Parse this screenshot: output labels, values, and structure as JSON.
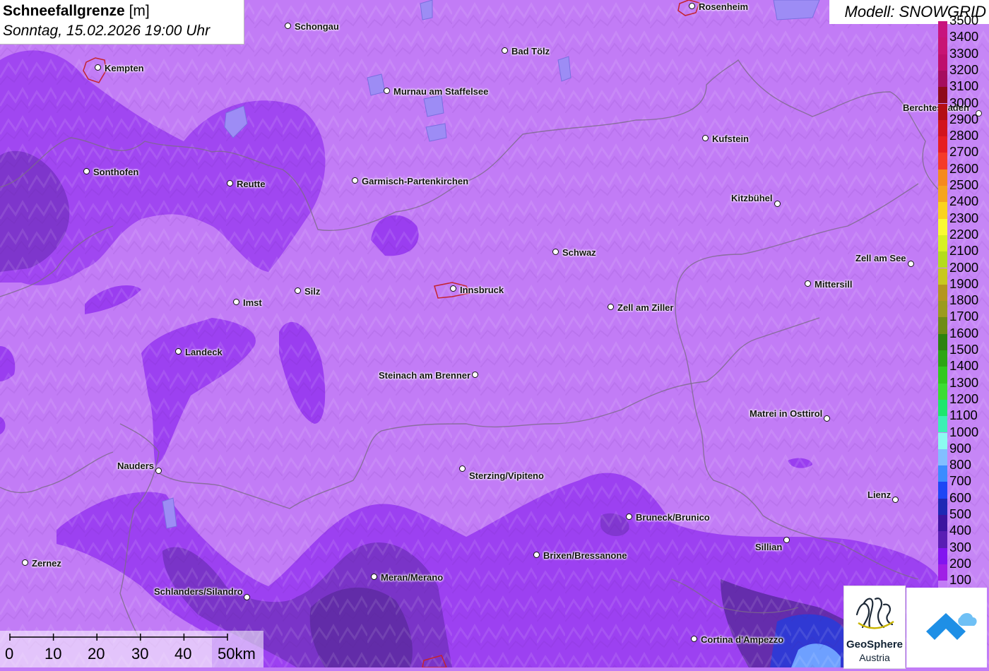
{
  "title": {
    "bold": "Schneefallgrenze",
    "unit": " [m]",
    "subtitle": "Sonntag, 15.02.2026 19:00 Uhr"
  },
  "model_label": "Modell: SNOWGRID",
  "legend": {
    "labels": [
      "3500",
      "3400",
      "3300",
      "3200",
      "3100",
      "3000",
      "2900",
      "2800",
      "2700",
      "2600",
      "2500",
      "2400",
      "2300",
      "2200",
      "2100",
      "2000",
      "1900",
      "1800",
      "1700",
      "1600",
      "1500",
      "1400",
      "1300",
      "1200",
      "1100",
      "1000",
      "900",
      "800",
      "700",
      "600",
      "500",
      "400",
      "300",
      "200",
      "100"
    ],
    "colors": [
      "#c8147e",
      "#c81474",
      "#be0f6c",
      "#a60d5f",
      "#8f0a1a",
      "#b40f14",
      "#d2141e",
      "#e61e23",
      "#f53a2a",
      "#f58a1e",
      "#f5a51e",
      "#fad21e",
      "#fafa32",
      "#d7f023",
      "#b4dc1e",
      "#c8c81e",
      "#b4961e",
      "#9b9b1e",
      "#6e8c14",
      "#2d820f",
      "#2da514",
      "#32c81e",
      "#3cdc32",
      "#1ee66e",
      "#3cf0b4",
      "#8cfaf0",
      "#82beff",
      "#3c8cff",
      "#1e46f5",
      "#1e28b4",
      "#3c14a0",
      "#5a1eb4",
      "#8214f0",
      "#a01ee6",
      "#c27cf6"
    ]
  },
  "cities": [
    {
      "name": "Rosenheim",
      "dot": [
        980,
        9
      ],
      "label": [
        989,
        2
      ],
      "align": "left"
    },
    {
      "name": "Schongau",
      "dot": [
        408,
        37
      ],
      "label": [
        417,
        30
      ],
      "align": "left"
    },
    {
      "name": "Bad Tölz",
      "dot": [
        715,
        72
      ],
      "label": [
        724,
        65
      ],
      "align": "left"
    },
    {
      "name": "Kempten",
      "dot": [
        139,
        96
      ],
      "label": [
        148,
        89
      ],
      "align": "left"
    },
    {
      "name": "Murnau am Staffelsee",
      "dot": [
        548,
        129
      ],
      "label": [
        557,
        122
      ],
      "align": "left"
    },
    {
      "name": "Berchtesgaden",
      "dot": [
        1386,
        161
      ],
      "label": [
        1278,
        145
      ],
      "align": "left"
    },
    {
      "name": "Kufstein",
      "dot": [
        999,
        196
      ],
      "label": [
        1008,
        189
      ],
      "align": "left"
    },
    {
      "name": "Sonthofen",
      "dot": [
        123,
        243
      ],
      "label": [
        132,
        236
      ],
      "align": "left"
    },
    {
      "name": "Garmisch-Partenkirchen",
      "dot": [
        503,
        256
      ],
      "label": [
        512,
        249
      ],
      "align": "left"
    },
    {
      "name": "Reutte",
      "dot": [
        326,
        260
      ],
      "label": [
        335,
        253
      ],
      "align": "left"
    },
    {
      "name": "Kitzbühel",
      "dot": [
        1101,
        289
      ],
      "label": [
        1094,
        273
      ],
      "align": "right"
    },
    {
      "name": "Schwaz",
      "dot": [
        787,
        357
      ],
      "label": [
        796,
        350
      ],
      "align": "left"
    },
    {
      "name": "Zell am See",
      "dot": [
        1290,
        374
      ],
      "label": [
        1283,
        358
      ],
      "align": "right"
    },
    {
      "name": "Mittersill",
      "dot": [
        1144,
        402
      ],
      "label": [
        1153,
        395
      ],
      "align": "left"
    },
    {
      "name": "Innsbruck",
      "dot": [
        642,
        409
      ],
      "label": [
        651,
        403
      ],
      "align": "left"
    },
    {
      "name": "Silz",
      "dot": [
        422,
        412
      ],
      "label": [
        431,
        405
      ],
      "align": "left"
    },
    {
      "name": "Imst",
      "dot": [
        335,
        428
      ],
      "label": [
        344,
        421
      ],
      "align": "left"
    },
    {
      "name": "Zell am Ziller",
      "dot": [
        865,
        435
      ],
      "label": [
        874,
        428
      ],
      "align": "left"
    },
    {
      "name": "Landeck",
      "dot": [
        253,
        498
      ],
      "label": [
        262,
        491
      ],
      "align": "left"
    },
    {
      "name": "Steinach am Brenner",
      "dot": [
        673,
        531
      ],
      "label": [
        666,
        524
      ],
      "align": "right"
    },
    {
      "name": "Matrei in Osttirol",
      "dot": [
        1171,
        593
      ],
      "label": [
        1164,
        578
      ],
      "align": "right"
    },
    {
      "name": "Nauders",
      "dot": [
        225,
        667
      ],
      "label": [
        218,
        652
      ],
      "align": "right"
    },
    {
      "name": "Sterzing/Vipiteno",
      "dot": [
        655,
        664
      ],
      "label": [
        664,
        666
      ],
      "align": "left"
    },
    {
      "name": "Lienz",
      "dot": [
        1268,
        708
      ],
      "label": [
        1261,
        693
      ],
      "align": "right"
    },
    {
      "name": "Bruneck/Brunico",
      "dot": [
        891,
        732
      ],
      "label": [
        900,
        725
      ],
      "align": "left"
    },
    {
      "name": "Sillian",
      "dot": [
        1114,
        765
      ],
      "label": [
        1107,
        767
      ],
      "align": "right"
    },
    {
      "name": "Brixen/Bressanone",
      "dot": [
        760,
        786
      ],
      "label": [
        769,
        779
      ],
      "align": "left"
    },
    {
      "name": "Zernez",
      "dot": [
        36,
        797
      ],
      "label": [
        45,
        790
      ],
      "align": "left"
    },
    {
      "name": "Meran/Merano",
      "dot": [
        530,
        817
      ],
      "label": [
        539,
        810
      ],
      "align": "left"
    },
    {
      "name": "Schlanders/Silandro",
      "dot": [
        350,
        846
      ],
      "label": [
        344,
        830
      ],
      "align": "right"
    },
    {
      "name": "Cortina d'Ampezzo",
      "dot": [
        983,
        905
      ],
      "label": [
        992,
        898
      ],
      "align": "left"
    }
  ],
  "scalebar": {
    "labels": [
      "0",
      "10",
      "20",
      "30",
      "40",
      "50km"
    ]
  },
  "logos": {
    "geosphere_line1": "GeoSphere",
    "geosphere_line2": "Austria"
  }
}
